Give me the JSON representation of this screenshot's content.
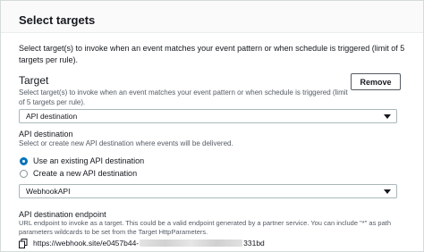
{
  "panel": {
    "title": "Select targets",
    "description": "Select target(s) to invoke when an event matches your event pattern or when schedule is triggered (limit of 5 targets per rule)."
  },
  "target": {
    "title": "Target",
    "description": "Select target(s) to invoke when an event matches your event pattern or when schedule is triggered (limit of 5 targets per rule).",
    "remove_label": "Remove",
    "selected_type": "API destination"
  },
  "api_destination": {
    "label": "API destination",
    "description": "Select or create new API destination where events will be delivered.",
    "options": [
      {
        "label": "Use an existing API destination",
        "checked": true
      },
      {
        "label": "Create a new API destination",
        "checked": false
      }
    ],
    "selected": "WebhookAPI"
  },
  "endpoint": {
    "label": "API destination endpoint",
    "description": "URL endpoint to invoke as a target. This could be a valid endpoint generated by a partner service. You can include \"*\" as path parameters wildcards to be set from the Target HttpParameters.",
    "url_prefix": "https://webhook.site/e0457b44-",
    "url_suffix": "331bd",
    "copy_icon": "copy-icon"
  },
  "colors": {
    "accent": "#0073bb",
    "border": "#aab7b8",
    "muted_text": "#545b64"
  }
}
